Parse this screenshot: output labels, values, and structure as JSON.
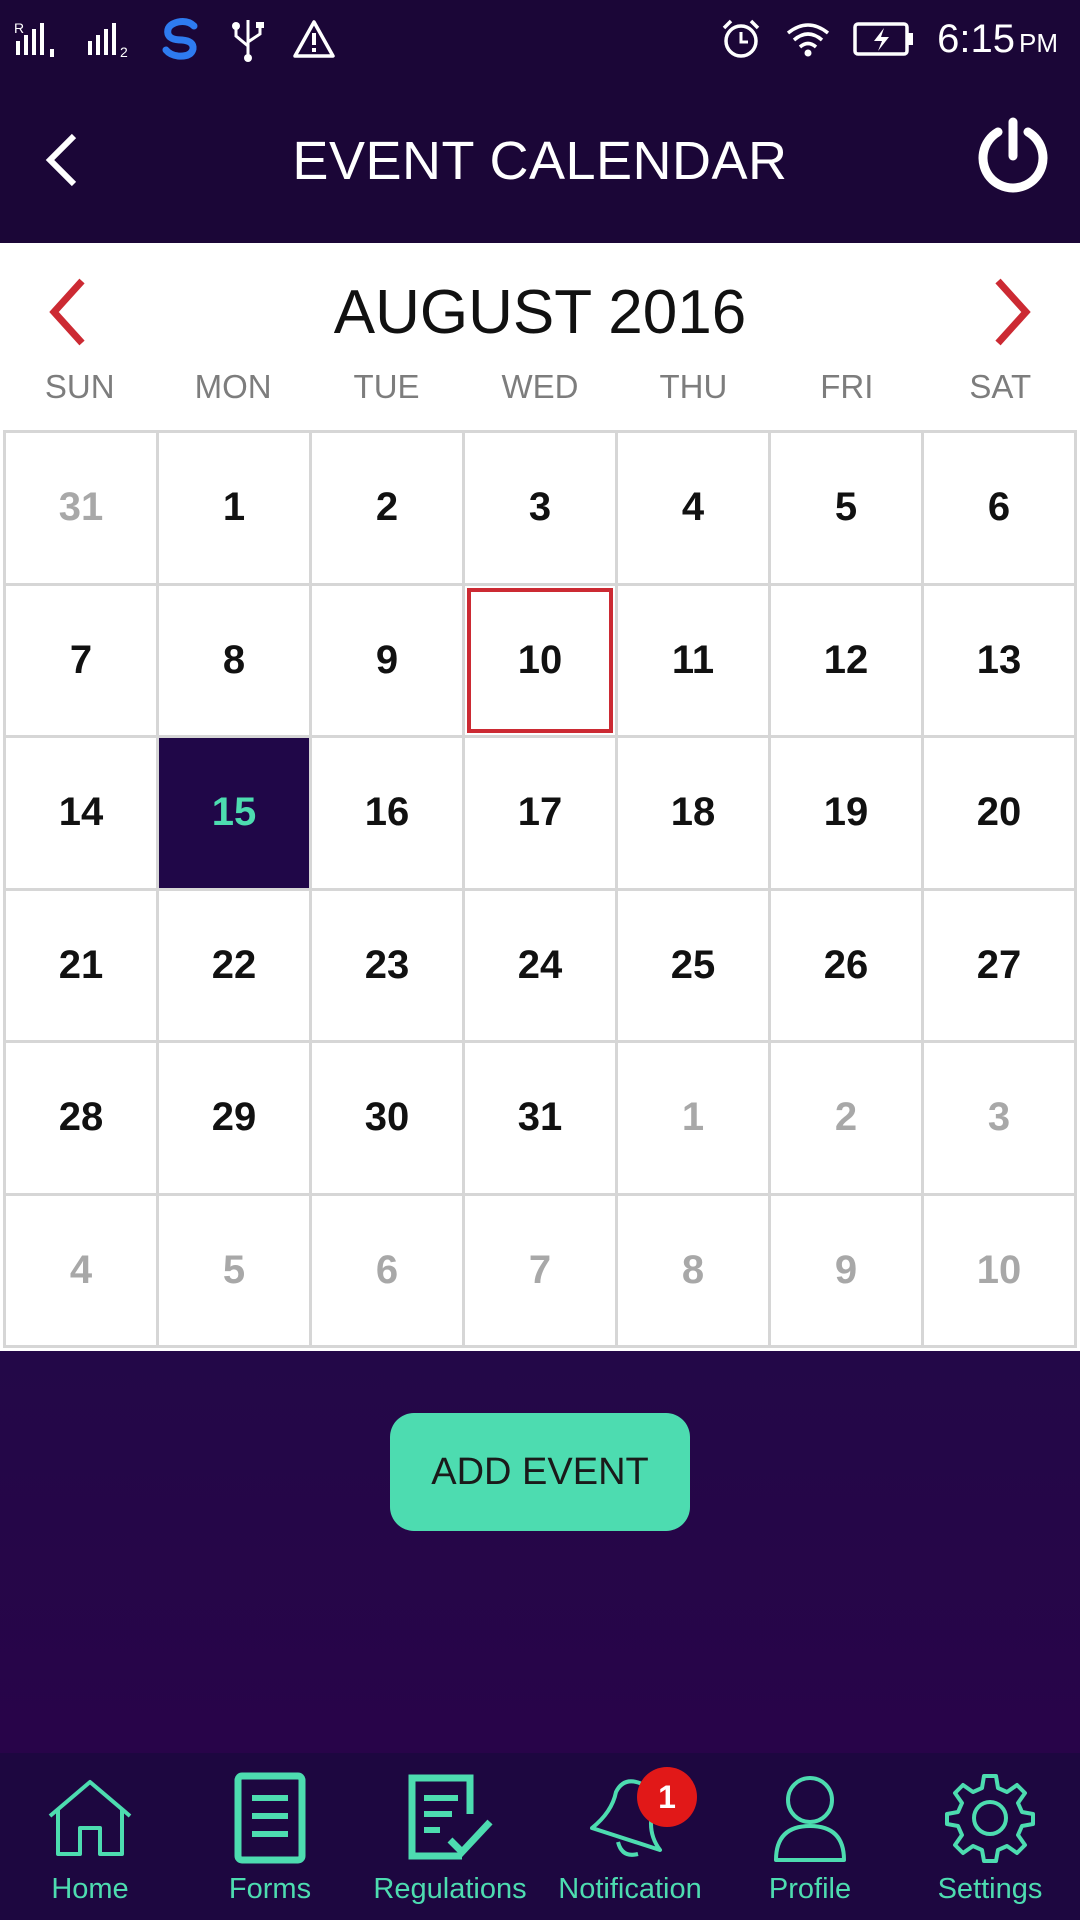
{
  "status_bar": {
    "time": "6:15",
    "ampm": "PM",
    "left_icons": [
      "signal-r-icon",
      "signal-2-icon",
      "s-app-icon",
      "usb-icon",
      "warning-icon"
    ],
    "right_icons": [
      "alarm-icon",
      "wifi-icon",
      "battery-charging-icon"
    ]
  },
  "header": {
    "title": "EVENT CALENDAR",
    "back_icon": "chevron-left-icon",
    "power_icon": "power-icon"
  },
  "calendar": {
    "month_label": "AUGUST 2016",
    "weekdays": [
      "SUN",
      "MON",
      "TUE",
      "WED",
      "THU",
      "FRI",
      "SAT"
    ],
    "weeks": [
      [
        {
          "d": "31",
          "muted": true
        },
        {
          "d": "1"
        },
        {
          "d": "2"
        },
        {
          "d": "3"
        },
        {
          "d": "4"
        },
        {
          "d": "5"
        },
        {
          "d": "6"
        }
      ],
      [
        {
          "d": "7"
        },
        {
          "d": "8"
        },
        {
          "d": "9"
        },
        {
          "d": "10",
          "selected": true
        },
        {
          "d": "11"
        },
        {
          "d": "12"
        },
        {
          "d": "13"
        }
      ],
      [
        {
          "d": "14"
        },
        {
          "d": "15",
          "today": true
        },
        {
          "d": "16"
        },
        {
          "d": "17"
        },
        {
          "d": "18"
        },
        {
          "d": "19"
        },
        {
          "d": "20"
        }
      ],
      [
        {
          "d": "21"
        },
        {
          "d": "22"
        },
        {
          "d": "23"
        },
        {
          "d": "24"
        },
        {
          "d": "25"
        },
        {
          "d": "26"
        },
        {
          "d": "27"
        }
      ],
      [
        {
          "d": "28"
        },
        {
          "d": "29"
        },
        {
          "d": "30"
        },
        {
          "d": "31"
        },
        {
          "d": "1",
          "muted": true
        },
        {
          "d": "2",
          "muted": true
        },
        {
          "d": "3",
          "muted": true
        }
      ],
      [
        {
          "d": "4",
          "muted": true
        },
        {
          "d": "5",
          "muted": true
        },
        {
          "d": "6",
          "muted": true
        },
        {
          "d": "7",
          "muted": true
        },
        {
          "d": "8",
          "muted": true
        },
        {
          "d": "9",
          "muted": true
        },
        {
          "d": "10",
          "muted": true
        }
      ]
    ],
    "colors": {
      "nav_arrow": "#cc2a33",
      "selected_border": "#cc2a33",
      "today_bg": "#200748",
      "today_text": "#4ddcb0"
    }
  },
  "actions": {
    "add_event_label": "ADD EVENT"
  },
  "tabs": [
    {
      "label": "Home",
      "icon": "home-icon"
    },
    {
      "label": "Forms",
      "icon": "forms-icon"
    },
    {
      "label": "Regulations",
      "icon": "regulations-icon"
    },
    {
      "label": "Notification",
      "icon": "bell-icon",
      "badge": "1"
    },
    {
      "label": "Profile",
      "icon": "profile-icon"
    },
    {
      "label": "Settings",
      "icon": "gear-icon"
    }
  ],
  "theme": {
    "primary_dark": "#1b0637",
    "accent": "#4ddcb0"
  }
}
